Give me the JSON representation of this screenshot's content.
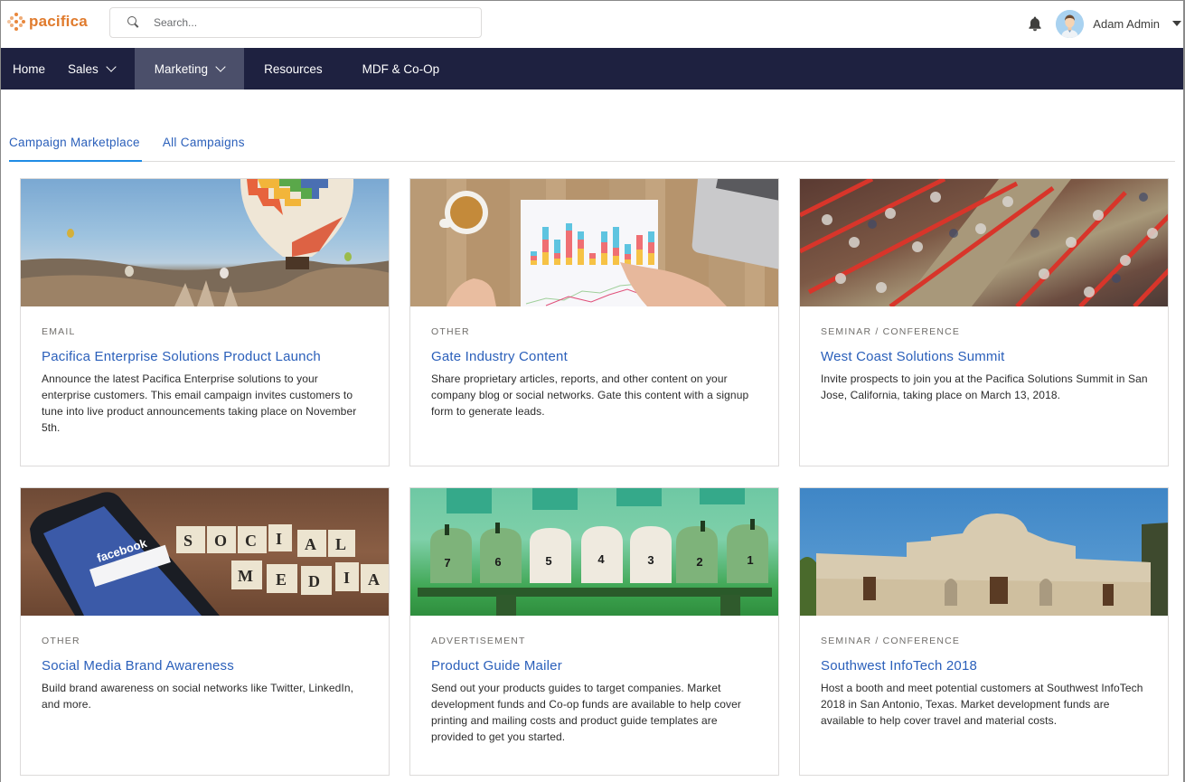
{
  "header": {
    "logo_text": "pacifica",
    "search_placeholder": "Search...",
    "user_name": "Adam Admin",
    "icons": {
      "search": "search-icon",
      "notifications": "bell-icon",
      "user_menu": "caret-down-icon"
    }
  },
  "nav": {
    "items": [
      {
        "label": "Home",
        "has_dropdown": false,
        "active": false
      },
      {
        "label": "Sales",
        "has_dropdown": true,
        "active": false
      },
      {
        "label": "Marketing",
        "has_dropdown": true,
        "active": true
      },
      {
        "label": "Resources",
        "has_dropdown": false,
        "active": false
      },
      {
        "label": "MDF & Co-Op",
        "has_dropdown": false,
        "active": false
      }
    ]
  },
  "tabs": [
    {
      "label": "Campaign Marketplace",
      "active": true
    },
    {
      "label": "All Campaigns",
      "active": false
    }
  ],
  "colors": {
    "brand": "#e07b2d",
    "nav_bg": "#1e2140",
    "nav_active": "#4b4f6a",
    "link": "#2a5fba",
    "tab_underline": "#1f8ce5"
  },
  "cards": [
    {
      "type": "Email",
      "title": "Pacifica Enterprise Solutions Product Launch",
      "description": "Announce the latest Pacifica Enterprise solutions to your enterprise customers. This email campaign invites customers to tune into live product announcements taking place on November 5th.",
      "image": "hot-air-balloons"
    },
    {
      "type": "Other",
      "title": "Gate Industry Content",
      "description": "Share proprietary articles, reports, and other content on your company blog or social networks. Gate this content with a signup form to generate leads.",
      "image": "chart-on-desk"
    },
    {
      "type": "Seminar / Conference",
      "title": "West Coast Solutions Summit",
      "description": "Invite prospects to join you at the Pacifica Solutions Summit in San Jose, California, taking place on March 13, 2018.",
      "image": "conference-audience"
    },
    {
      "type": "Other",
      "title": "Social Media Brand Awareness",
      "description": "Build brand awareness on social networks like Twitter, LinkedIn, and more.",
      "image": "social-media-tiles",
      "image_text": {
        "phone": "facebook",
        "tiles_row1": "SOCIAL",
        "tiles_row2": "MEDIA"
      }
    },
    {
      "type": "Advertisement",
      "title": "Product Guide Mailer",
      "description": "Send out your products guides to target companies. Market development funds and Co-op funds are available to help cover printing and mailing costs and product guide templates are provided to get you started.",
      "image": "mailboxes",
      "image_text": {
        "mailbox_numbers": [
          "7",
          "6",
          "5",
          "4",
          "3",
          "2",
          "1"
        ]
      }
    },
    {
      "type": "Seminar / Conference",
      "title": "Southwest InfoTech 2018",
      "description": "Host a booth and meet potential customers at Southwest InfoTech 2018 in San Antonio, Texas. Market development funds are available to help cover travel and material costs.",
      "image": "alamo-building"
    }
  ]
}
